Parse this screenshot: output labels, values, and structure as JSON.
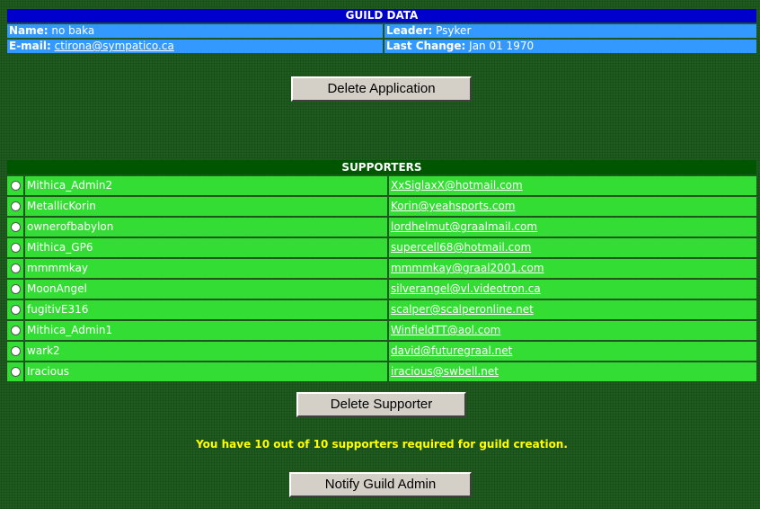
{
  "guild": {
    "header": "GUILD DATA",
    "name_label": "Name:",
    "name_value": "no baka",
    "leader_label": "Leader:",
    "leader_value": "Psyker",
    "email_label": "E-mail:",
    "email_value": "ctirona@sympatico.ca",
    "last_change_label": "Last Change:",
    "last_change_value": "Jan 01 1970"
  },
  "buttons": {
    "delete_application": "Delete Application",
    "delete_supporter": "Delete Supporter",
    "notify_guild_admin": "Notify Guild Admin"
  },
  "supporters": {
    "header": "SUPPORTERS",
    "rows": [
      {
        "name": "Mithica_Admin2",
        "email": "XxSiglaxX@hotmail.com"
      },
      {
        "name": "MetallicKorin",
        "email": "Korin@yeahsports.com"
      },
      {
        "name": "ownerofbabylon",
        "email": "lordhelmut@graalmail.com"
      },
      {
        "name": "Mithica_GP6",
        "email": "supercell68@hotmail.com"
      },
      {
        "name": "mmmmkay",
        "email": "mmmmkay@graal2001.com"
      },
      {
        "name": "MoonAngel",
        "email": "silverangel@vl.videotron.ca"
      },
      {
        "name": "fugitivE316",
        "email": "scalper@scalperonline.net"
      },
      {
        "name": "Mithica_Admin1",
        "email": "WinfieldTT@aol.com"
      },
      {
        "name": "wark2",
        "email": "david@futuregraal.net"
      },
      {
        "name": "Iracious",
        "email": "iracious@swbell.net"
      }
    ]
  },
  "status_message": "You have 10 out of 10 supporters required for guild creation.",
  "colors": {
    "background": "#1f5a1f",
    "guild_header": "#0000cc",
    "guild_cell": "#3399ff",
    "supporters_header": "#005500",
    "supporter_row": "#33dd33",
    "status_text": "#ffff00"
  }
}
